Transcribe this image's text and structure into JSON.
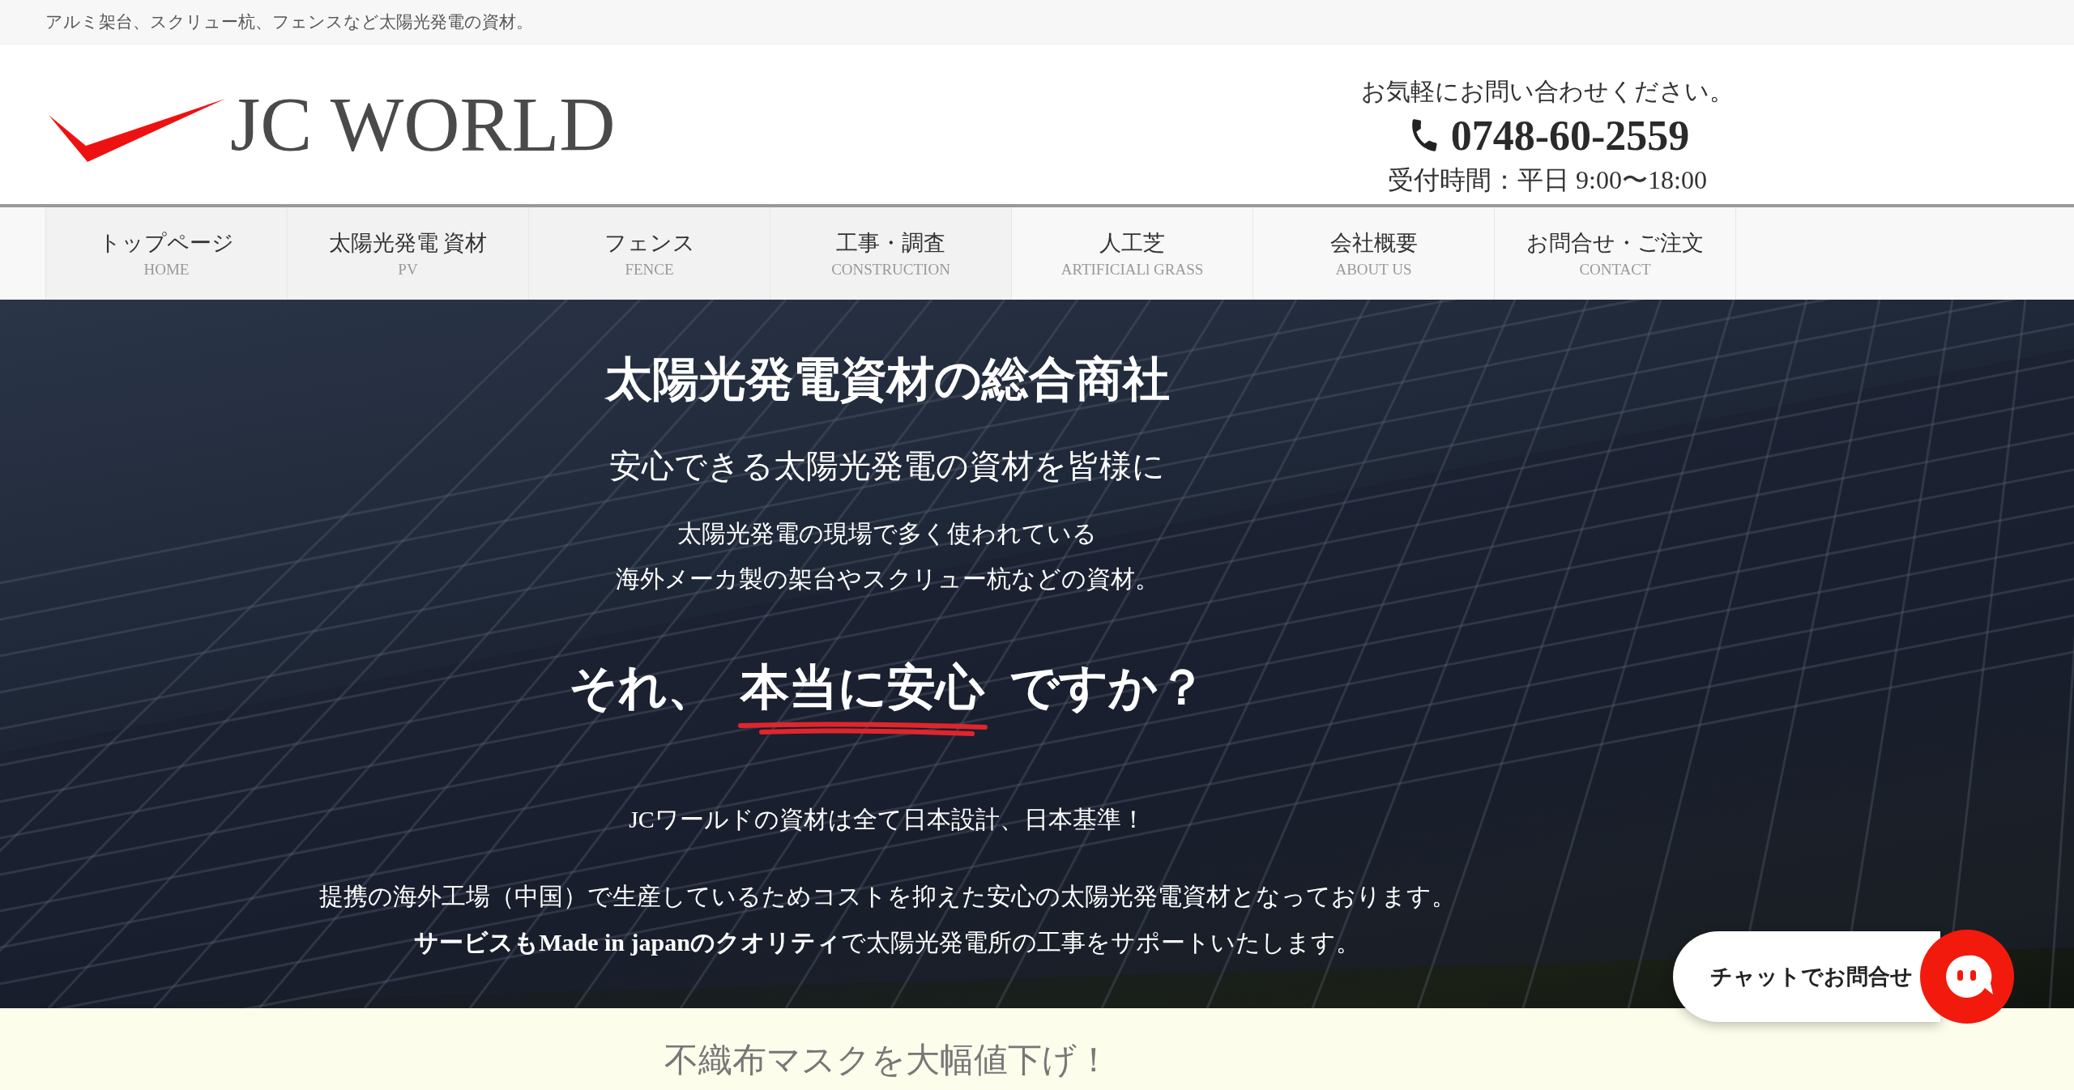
{
  "top_bar": {
    "tagline": "アルミ架台、スクリュー杭、フェンスなど太陽光発電の資材。"
  },
  "header": {
    "logo_text": "JC WORLD",
    "contact": {
      "note": "お気軽にお問い合わせください。",
      "phone": "0748-60-2559",
      "hours": "受付時間：平日 9:00〜18:00"
    }
  },
  "nav": [
    {
      "label": "トップページ",
      "sublabel": "HOME"
    },
    {
      "label": "太陽光発電 資材",
      "sublabel": "PV"
    },
    {
      "label": "フェンス",
      "sublabel": "FENCE"
    },
    {
      "label": "工事・調査",
      "sublabel": "CONSTRUCTION"
    },
    {
      "label": "人工芝",
      "sublabel": "ARTIFICIALl GRASS"
    },
    {
      "label": "会社概要",
      "sublabel": "ABOUT US"
    },
    {
      "label": "お問合せ・ご注文",
      "sublabel": "CONTACT"
    }
  ],
  "hero": {
    "title": "太陽光発電資材の総合商社",
    "subtitle": "安心できる太陽光発電の資材を皆様に",
    "intro": [
      "太陽光発電の現場で多く使われている",
      "海外メーカ製の架台やスクリュー杭などの資材。"
    ],
    "question": {
      "before": "それ、",
      "emphasis": "本当に安心",
      "after": "ですか？"
    },
    "statement": "JCワールドの資材は全て日本設計、日本基準！",
    "paragraphs": [
      "提携の海外工場（中国）で生産しているためコストを抑えた安心の太陽光発電資材となっております。",
      "**サービスもMade in japanのクオリティ**で太陽光発電所の工事をサポートいたします。"
    ]
  },
  "notice": {
    "headline": "不織布マスクを大幅値下げ！"
  },
  "chat": {
    "label": "チャットでお問合せ"
  }
}
